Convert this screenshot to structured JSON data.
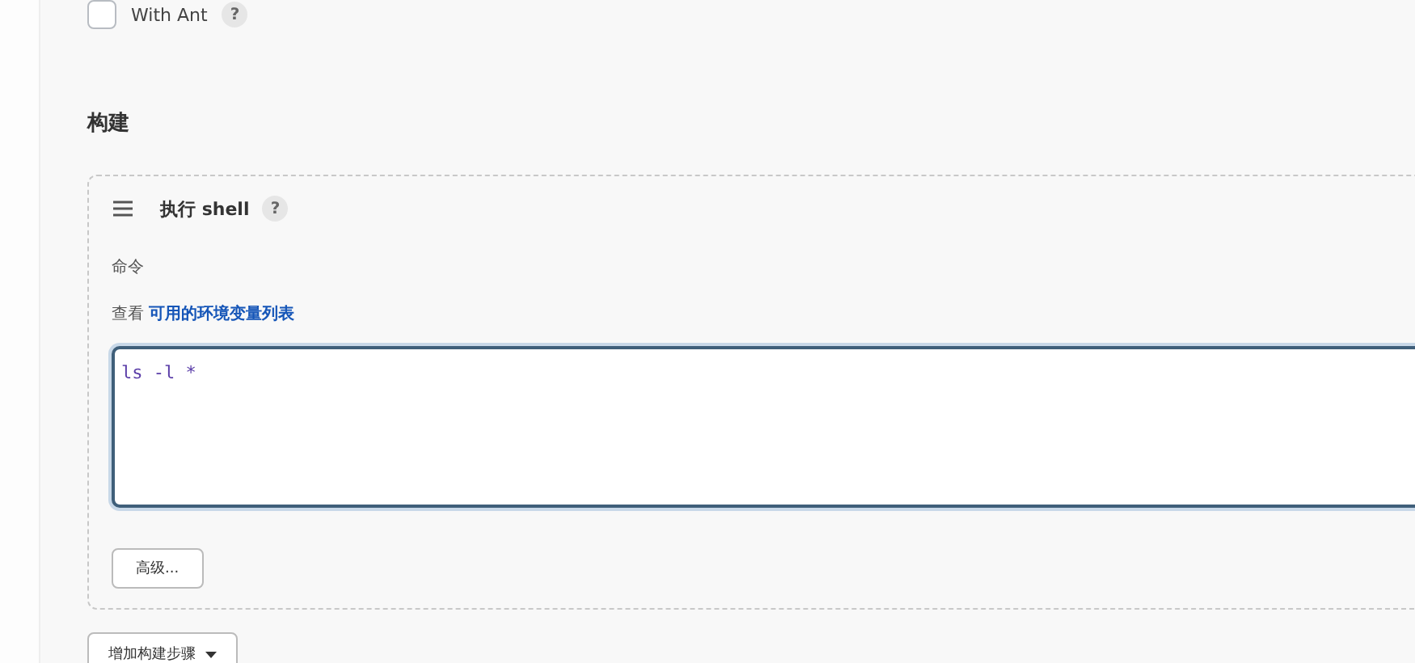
{
  "option": {
    "label": "With Ant",
    "checked": false,
    "help": "?"
  },
  "section": {
    "title": "构建"
  },
  "step": {
    "title": "执行 shell",
    "help": "?",
    "command_label": "命令",
    "hint": "查看",
    "hint_link": "可用的环境变量列表",
    "command": "ls -l *",
    "advanced_button": "高级..."
  },
  "add_button": "增加构建步骤"
}
